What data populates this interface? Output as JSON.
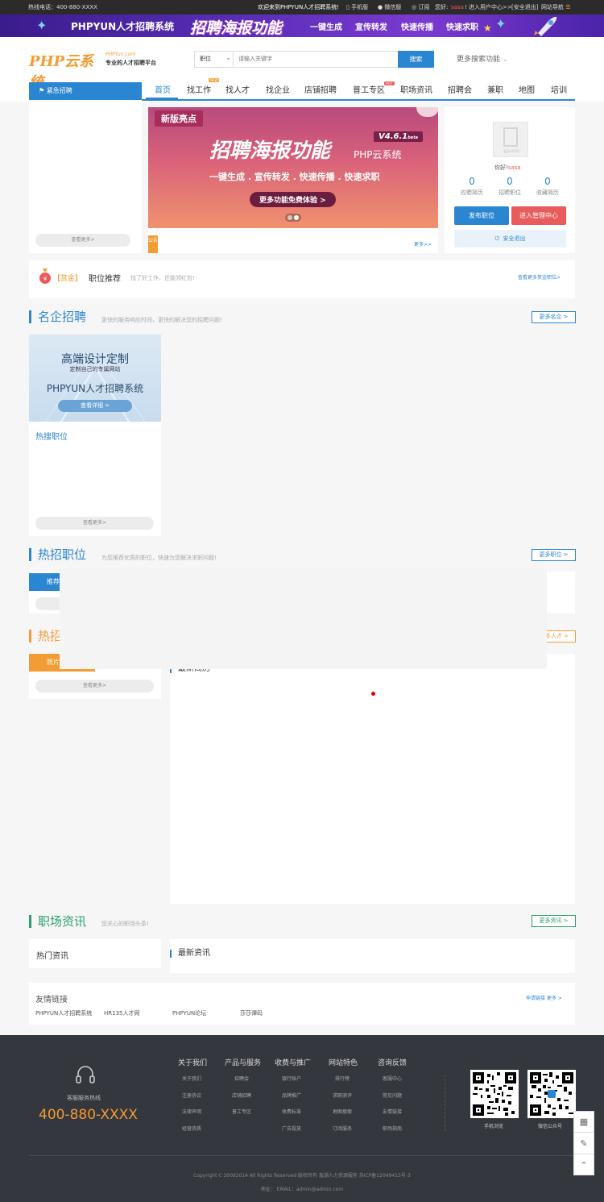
{
  "topbar": {
    "hotline": "热线电话：400-880-XXXX",
    "welcome": "欢迎来到PHPYUN人才招聘系统!",
    "mobile": "手机版",
    "wechat": "微信版",
    "subscribe": "订阅",
    "hello": "您好:",
    "user": "sasa",
    "enter_center": "! 进入用户中心>>",
    "logout": "[安全退出]",
    "site_nav": "网站导航"
  },
  "banner": {
    "brand": "PHPYUN人才招聘系统",
    "feature": "招聘海报功能",
    "tags": [
      "一键生成",
      "宣传转发",
      "快速传播",
      "快速求职"
    ]
  },
  "header": {
    "logo_text": "PHP云系统",
    "logo_sub_top": "PHPYun.com",
    "logo_sub": "专业的人才招聘平台",
    "search_type": "职位",
    "search_placeholder": "请输入关键字",
    "search_button": "搜索",
    "more_search": "更多搜索功能"
  },
  "nav": {
    "urgent": "紧急招聘",
    "items": [
      "首页",
      "找工作",
      "找人才",
      "找企业",
      "店铺招聘",
      "普工专区",
      "职场资讯",
      "招聘会",
      "兼职",
      "地图",
      "培训"
    ],
    "badge_new": "NEW",
    "badge_hot": "HOT"
  },
  "left_panel": {
    "more": "查看更多>"
  },
  "slider": {
    "tag": "新版亮点",
    "title": "招聘海报功能",
    "version": "V4.6.1",
    "version_suffix": "beta",
    "brand": "PHP云系统",
    "subtitle": "一键生成 . 宣传转发 . 快速传播 . 快速求职",
    "cta": "更多功能免费体验 >",
    "notice_label": "公告",
    "notice_more": "更多>>"
  },
  "user_card": {
    "avatar_text": "暂无LOGO",
    "hello": "你好!",
    "name": "sasa",
    "stats": [
      {
        "num": "0",
        "label": "应聘简历"
      },
      {
        "num": "0",
        "label": "招聘职位"
      },
      {
        "num": "0",
        "label": "收藏简历"
      }
    ],
    "publish": "发布职位",
    "manage": "进入管理中心",
    "logout": "安全退出"
  },
  "reward": {
    "badge": "【赏金】",
    "title": "职位推荐",
    "sub": "找了好工作，还能领红包!",
    "more": "查看更多赏金职位>"
  },
  "famous": {
    "title": "名企招聘",
    "sub": "更快的服务响应时间，更快的解决您的招聘问题!",
    "more": "更多名企 >",
    "ad_title": "高端设计定制",
    "ad_sub": "定制自己的专属网站",
    "ad_brand": "PHPYUN人才招聘系统",
    "ad_btn": "查看详细 >",
    "hot_jobs": "热搜职位",
    "view_more": "查看更多>"
  },
  "hotjobs": {
    "title": "热招职位",
    "sub": "为您推荐优质的职位，快速为您解决求职问题!",
    "more": "更多职位 >",
    "tab": "推荐"
  },
  "talent": {
    "title": "热招",
    "tab": "照片",
    "more": "多人才 >",
    "latest": "最新简历",
    "view_more": "查看更多>"
  },
  "news": {
    "title": "职场资讯",
    "sub": "您关心的职场头条!",
    "more": "更多资讯 >",
    "hot": "热门资讯",
    "latest": "最新资讯"
  },
  "links": {
    "title": "友情链接",
    "apply": "申请链接",
    "more": "更多 >",
    "items": [
      "PHPYUN人才招聘系统",
      "HR135人才网",
      "PHPYUN论坛",
      "莎莎谭码"
    ]
  },
  "footer": {
    "hotline_label": "客服服务热线",
    "hotline": "400-880-XXXX",
    "cols": [
      {
        "title": "关于我们",
        "links": [
          "关于我们",
          "注册协议",
          "法律声明",
          "经营资质"
        ]
      },
      {
        "title": "产品与服务",
        "links": [
          "招聘会",
          "店铺招聘",
          "普工专区"
        ]
      },
      {
        "title": "收费与推广",
        "links": [
          "银行帐户",
          "品牌推广",
          "收费标准",
          "广告投放"
        ]
      },
      {
        "title": "网站特色",
        "links": [
          "排行榜",
          "求职测评",
          "地图搜索",
          "订阅服务"
        ]
      },
      {
        "title": "咨询反馈",
        "links": [
          "客服中心",
          "常见问题",
          "友情链接",
          "职场指南"
        ]
      }
    ],
    "qr1": "手机浏览",
    "qr2": "微信公众号",
    "copyright": "Copyright C 20092014 All Rights Reserved 版权所有 鑫潮人力资源服务 苏ICP备12049413号-3",
    "contact": "地址：  EMAIL：admin@admin.com"
  },
  "colors": {
    "primary": "#2b86d1",
    "orange": "#f39c34",
    "red": "#e85c5c",
    "footer_bg": "#34373d",
    "slider_pink": "#c0395f"
  }
}
